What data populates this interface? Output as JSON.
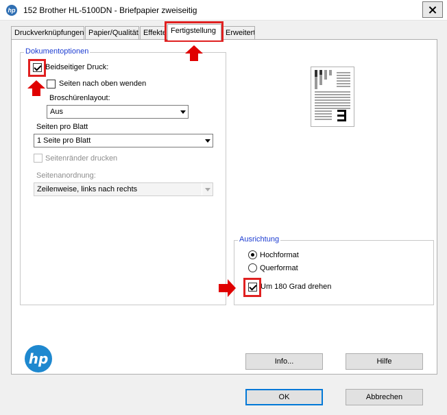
{
  "window": {
    "title": "152 Brother HL-5100DN - Briefpapier zweiseitig"
  },
  "tabs": [
    {
      "label": "Druckverknüpfungen"
    },
    {
      "label": "Papier/Qualität"
    },
    {
      "label": "Effekte"
    },
    {
      "label": "Fertigstellung"
    },
    {
      "label": "Erweitert"
    }
  ],
  "dokumentoptionen": {
    "legend": "Dokumentoptionen",
    "beidseitig_label": "Beidseitiger Druck:",
    "beidseitig_checked": true,
    "seiten_oben_label": "Seiten nach oben wenden",
    "seiten_oben_checked": false,
    "broschuere_label": "Broschürenlayout:",
    "broschuere_value": "Aus",
    "seiten_pro_blatt_label": "Seiten pro Blatt",
    "seiten_pro_blatt_value": "1 Seite pro Blatt",
    "seitenraender_label": "Seitenränder drucken",
    "seitenanordnung_label": "Seitenanordnung:",
    "seitenanordnung_value": "Zeilenweise, links nach rechts"
  },
  "ausrichtung": {
    "legend": "Ausrichtung",
    "hochformat_label": "Hochformat",
    "querformat_label": "Querformat",
    "selected": "Hochformat",
    "drehen_label": "Um 180 Grad drehen",
    "drehen_checked": true
  },
  "buttons": {
    "info_label": "Info...",
    "hilfe_label": "Hilfe",
    "ok_label": "OK",
    "abbrechen_label": "Abbrechen"
  },
  "logo": {
    "text": "hp"
  },
  "colors": {
    "legend_blue": "#1b3bd1",
    "highlight_red": "#e02020",
    "hp_blue": "#1e88cf",
    "focus_blue": "#0078d7"
  }
}
